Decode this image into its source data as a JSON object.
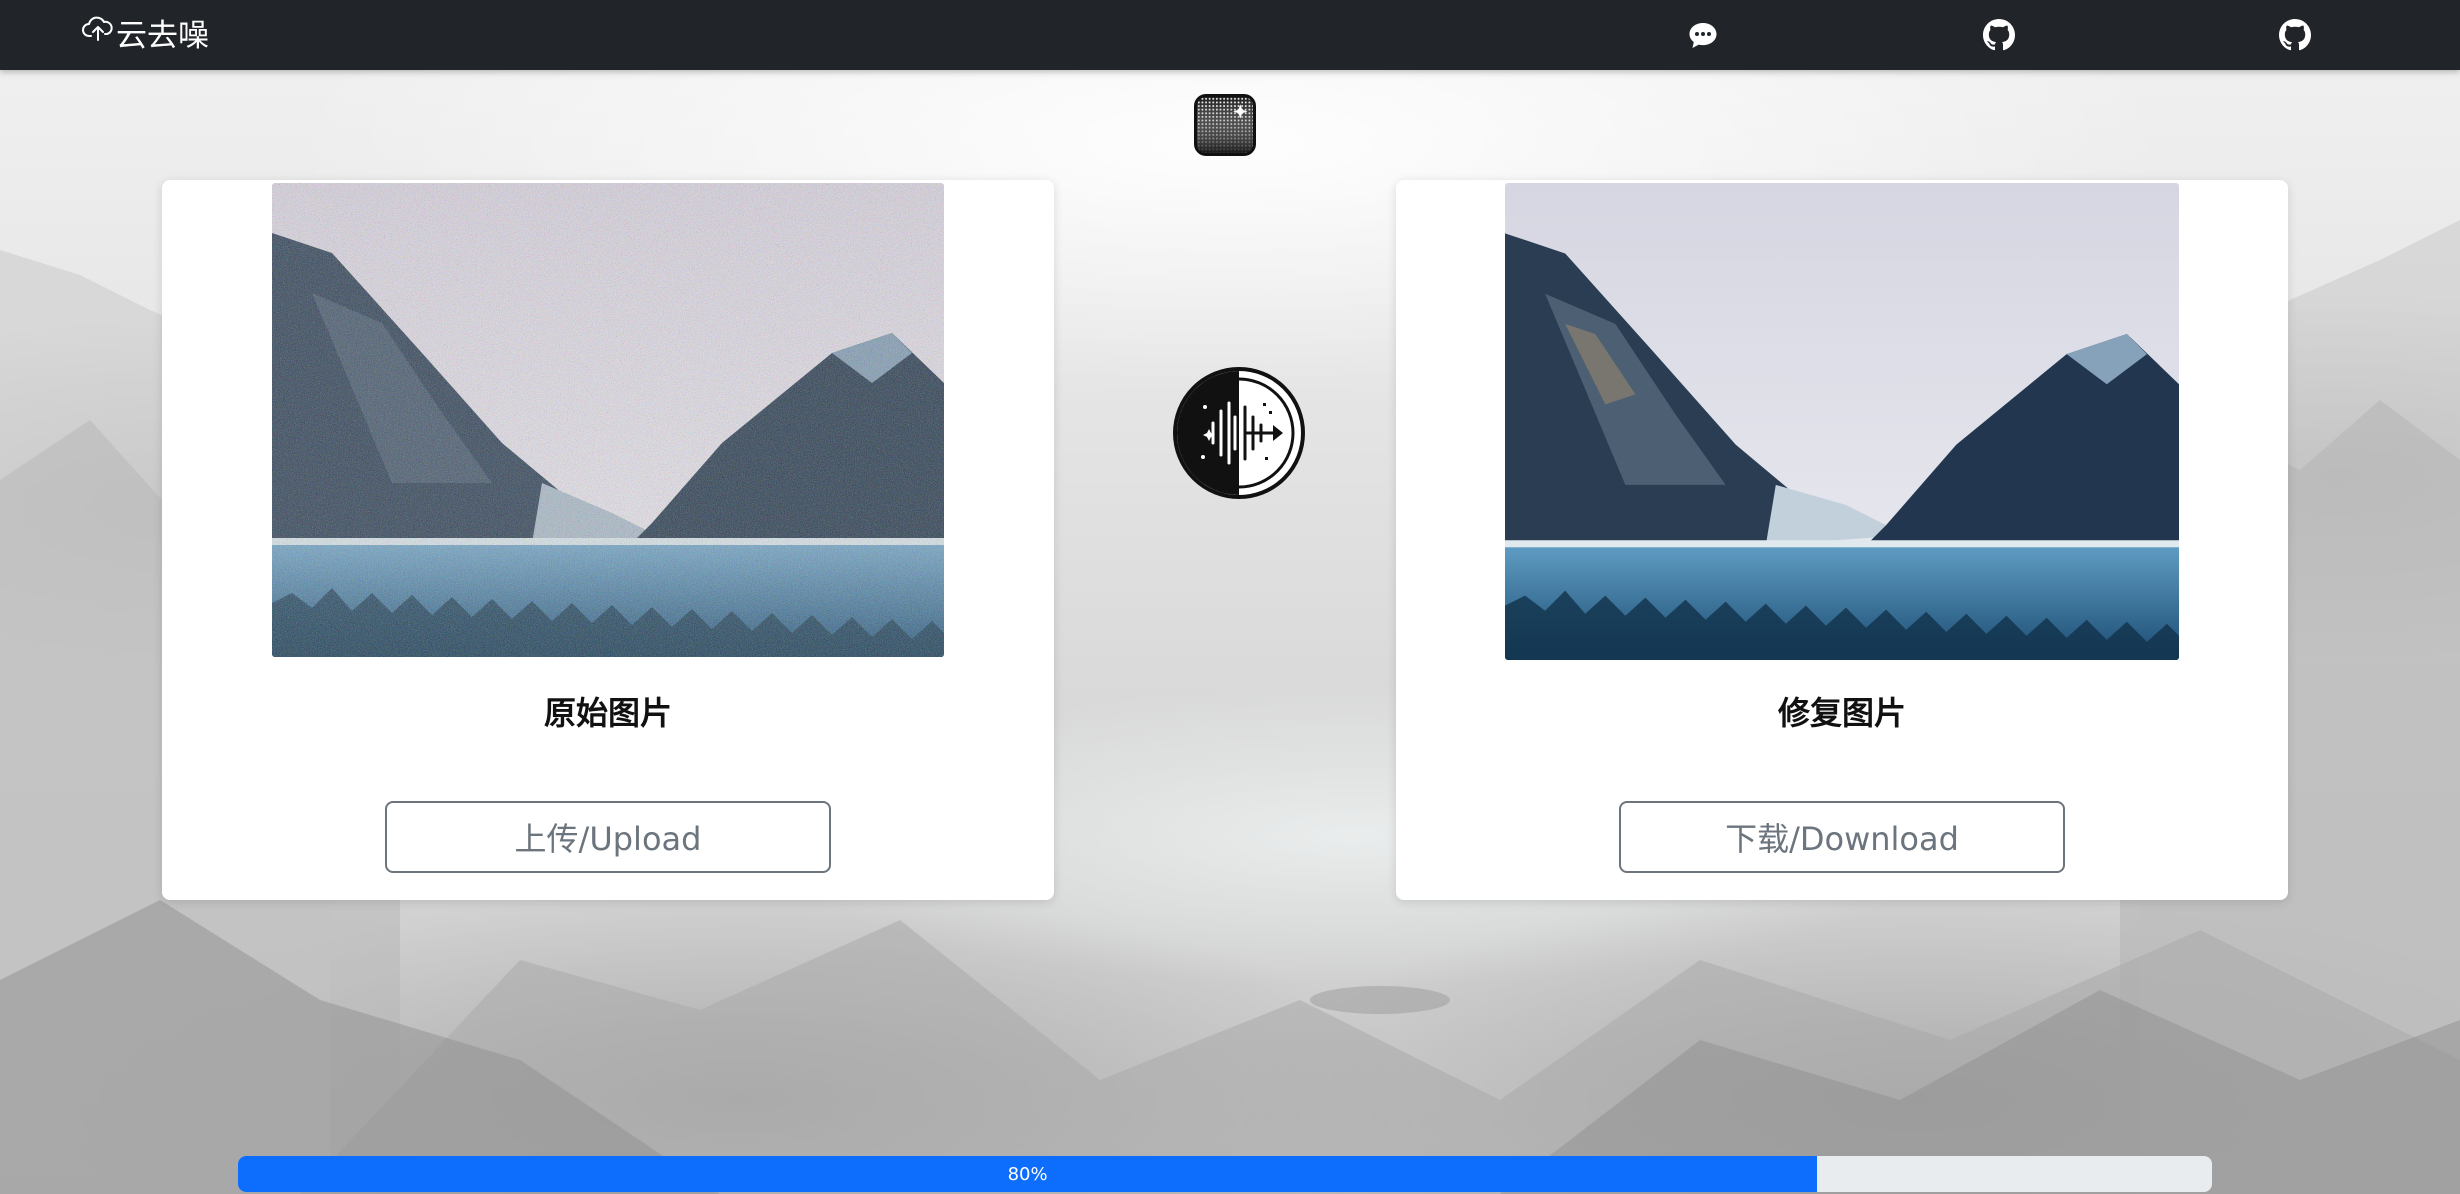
{
  "navbar": {
    "brand_text": "云去噪",
    "brand_icon": "cloud-upload-icon",
    "icons": [
      "chat-icon",
      "github-icon",
      "github-icon"
    ],
    "background": "#212529"
  },
  "original_panel": {
    "caption": "原始图片",
    "button_label": "上传/Upload"
  },
  "restored_panel": {
    "caption": "修复图片",
    "button_label": "下载/Download"
  },
  "progress": {
    "label": "80%",
    "value": 0.8,
    "color": "#0d6efd"
  }
}
